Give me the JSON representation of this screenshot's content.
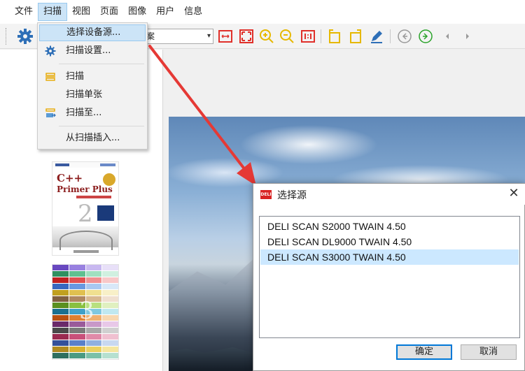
{
  "menubar": {
    "items": [
      "文件",
      "扫描",
      "视图",
      "页面",
      "图像",
      "用户",
      "信息"
    ],
    "active_index": 1
  },
  "toolbar": {
    "select_value": "案",
    "icons": [
      "gear-icon",
      "fit-width-icon",
      "fit-page-icon",
      "zoom-in-icon",
      "zoom-out-icon",
      "actual-size-icon",
      "rotate-left-icon",
      "rotate-right-icon",
      "edit-icon",
      "prev-circle-icon",
      "next-circle-icon",
      "prev-page-icon",
      "next-page-icon"
    ]
  },
  "scan_menu": {
    "items": [
      {
        "label": "选择设备源...",
        "icon": "",
        "highlighted": true
      },
      {
        "label": "扫描设置...",
        "icon": "gear-icon"
      },
      {
        "label": "扫描",
        "icon": "scan-icon"
      },
      {
        "label": "扫描单张",
        "icon": ""
      },
      {
        "label": "扫描至...",
        "icon": "scan-to-icon"
      },
      {
        "label": "从扫描插入...",
        "icon": ""
      }
    ]
  },
  "thumbnails": {
    "book1": {
      "title_line1": "C++",
      "title_line2": "Primer Plus",
      "volume": "2"
    },
    "book2": {
      "volume": "3"
    }
  },
  "dialog": {
    "logo_text": "DELI",
    "title": "选择源",
    "close_glyph": "✕",
    "sources": [
      "DELI SCAN S2000 TWAIN 4.50",
      "DELI SCAN DL9000 TWAIN 4.50",
      "DELI SCAN S3000 TWAIN 4.50"
    ],
    "selected_index": 2,
    "ok_label": "确定",
    "cancel_label": "取消"
  },
  "colors": {
    "accent": "#0078d7",
    "toolbar_red": "#e0302a",
    "toolbar_yellow": "#e6b800",
    "toolbar_green": "#2aa32a",
    "arrow_red": "#e53935",
    "highlight": "#cce4f7"
  }
}
